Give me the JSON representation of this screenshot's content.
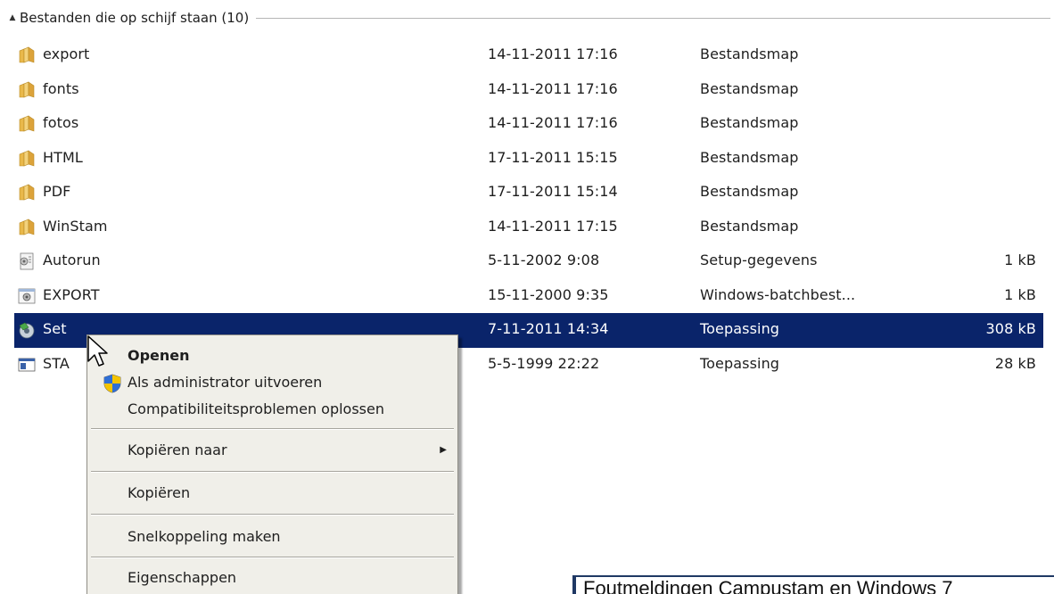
{
  "group": {
    "title": "Bestanden die op schijf staan (10)"
  },
  "files": [
    {
      "icon": "folder-icon",
      "name": "export",
      "date": "14-11-2011 17:16",
      "type": "Bestandsmap",
      "size": ""
    },
    {
      "icon": "folder-icon",
      "name": "fonts",
      "date": "14-11-2011 17:16",
      "type": "Bestandsmap",
      "size": ""
    },
    {
      "icon": "folder-icon",
      "name": "fotos",
      "date": "14-11-2011 17:16",
      "type": "Bestandsmap",
      "size": ""
    },
    {
      "icon": "folder-icon",
      "name": "HTML",
      "date": "17-11-2011 15:15",
      "type": "Bestandsmap",
      "size": ""
    },
    {
      "icon": "folder-icon",
      "name": "PDF",
      "date": "17-11-2011 15:14",
      "type": "Bestandsmap",
      "size": ""
    },
    {
      "icon": "folder-icon",
      "name": "WinStam",
      "date": "14-11-2011 17:15",
      "type": "Bestandsmap",
      "size": ""
    },
    {
      "icon": "setup-info-icon",
      "name": "Autorun",
      "date": "5-11-2002 9:08",
      "type": "Setup-gegevens",
      "size": "1 kB"
    },
    {
      "icon": "batch-file-icon",
      "name": "EXPORT",
      "date": "15-11-2000 9:35",
      "type": "Windows-batchbest...",
      "size": "1 kB"
    },
    {
      "icon": "setup-app-icon",
      "name": "Set",
      "date": "7-11-2011 14:34",
      "type": "Toepassing",
      "size": "308 kB",
      "selected": true
    },
    {
      "icon": "application-icon",
      "name": "STA",
      "date": "5-5-1999 22:22",
      "type": "Toepassing",
      "size": "28 kB"
    }
  ],
  "context_menu": {
    "items": [
      {
        "label": "Openen",
        "default": true
      },
      {
        "label": "Als administrator uitvoeren",
        "icon": "uac-shield-icon"
      },
      {
        "label": "Compatibiliteitsproblemen oplossen"
      },
      {
        "label": "Kopiëren naar",
        "submenu": true
      },
      {
        "label": "Kopiëren"
      },
      {
        "label": "Snelkoppeling maken"
      },
      {
        "label": "Eigenschappen"
      }
    ]
  },
  "caption": {
    "text": "Foutmeldingen Campustam  en  Windows 7"
  },
  "colors": {
    "selection": "#0a246a",
    "menu_background": "#f0efe9",
    "caption_border": "#1f3864"
  }
}
